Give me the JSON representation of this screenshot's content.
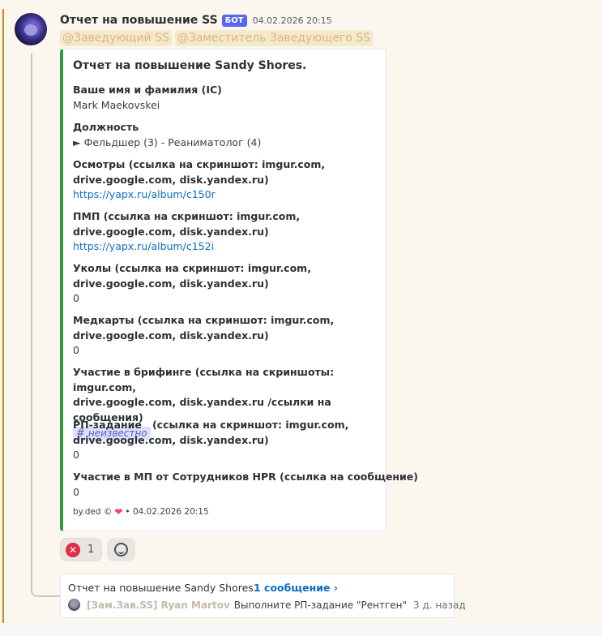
{
  "message": {
    "author": "Отчет на повышение SS",
    "bot_tag": "БОТ",
    "timestamp": "04.02.2026 20:15",
    "mentions": [
      "@Заведующий SS",
      "@Заместитель Заведующего SS"
    ]
  },
  "embed": {
    "accent_color": "#2f9a43",
    "title": "Отчет на повышение Sandy Shores.",
    "fields": [
      {
        "name": "Ваше имя и фамилия (IC)",
        "value": "Mark Maekovskei"
      },
      {
        "name": "Должность",
        "value": "► Фельдшер (3) - Реаниматолог (4)"
      },
      {
        "name_lines": [
          "Осмотры (ссылка на скриншот: imgur.com,",
          "drive.google.com, disk.yandex.ru)"
        ],
        "value": "https://yapx.ru/album/c150r"
      },
      {
        "name_lines": [
          "ПМП (ссылка на скриншот: imgur.com,",
          "drive.google.com, disk.yandex.ru)"
        ],
        "value": "https://yapx.ru/album/c152i"
      },
      {
        "name_lines": [
          "Уколы (ссылка на скриншот: imgur.com,",
          "drive.google.com, disk.yandex.ru)"
        ],
        "value": "0"
      },
      {
        "name_lines": [
          "Медкарты (ссылка на скриншот: imgur.com,",
          "drive.google.com, disk.yandex.ru)"
        ],
        "value": "0"
      },
      {
        "name_lines": [
          "Участие в брифинге (ссылка на скриншоты: imgur.com,",
          "drive.google.com, disk.yandex.ru /ссылки на сообщения)"
        ],
        "value": "неизвестно",
        "value_icon": "hashtag-icon"
      },
      {
        "name_lines": [
          "РП-задание   (ссылка на скриншот: imgur.com,",
          "drive.google.com, disk.yandex.ru)"
        ],
        "value": "0"
      },
      {
        "name": "Участие в МП от Сотрудников HPR (ссылка на сообщение)",
        "value": "0"
      }
    ],
    "footer": {
      "left": "by.ded ©",
      "icon": "heart-icon",
      "timestamp": "• 04.02.2026 20:15"
    }
  },
  "reactions": [
    {
      "icon": "cross-mark-icon",
      "count": "1"
    },
    {
      "icon": "add-reaction-icon"
    }
  ],
  "thread": {
    "title": "Отчет на повышение Sandy Shores.",
    "count": "1 сообщение ›",
    "last_author": "[Зам.Зав.SS] Ryan Martov",
    "last_message": "Выполните РП-задание \"Рентген\"",
    "last_time": "3 д. назад"
  }
}
